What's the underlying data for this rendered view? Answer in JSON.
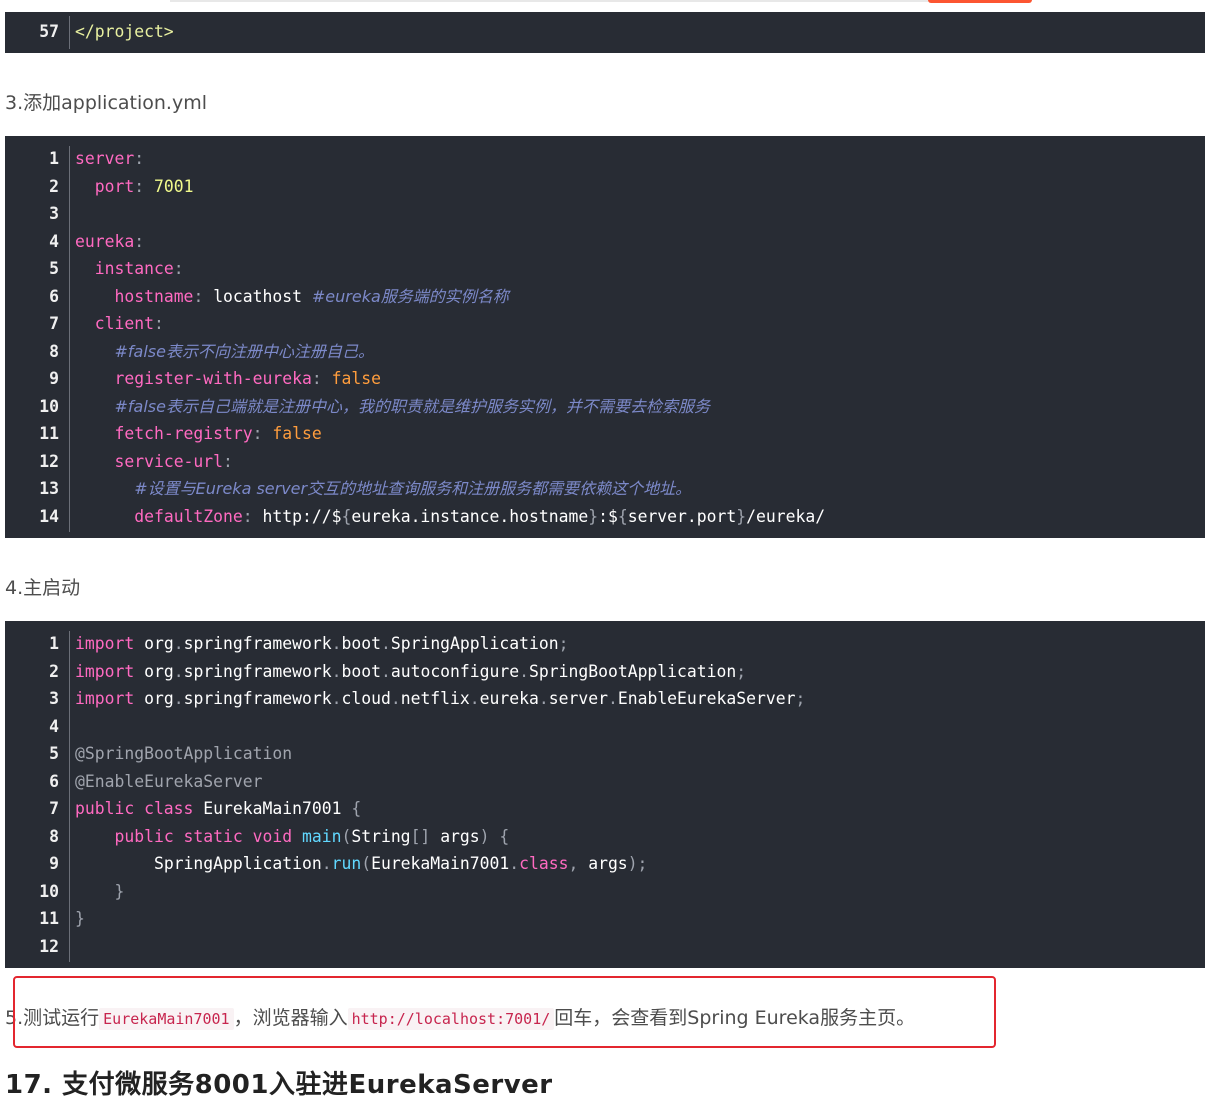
{
  "block_pom_tail": {
    "line_number": "57",
    "line_text": "</project>"
  },
  "step3_text": "3.添加application.yml",
  "yml": {
    "line_numbers": [
      "1",
      "2",
      "3",
      "4",
      "5",
      "6",
      "7",
      "8",
      "9",
      "10",
      "11",
      "12",
      "13",
      "14"
    ],
    "server_key": "server",
    "port_key": "port",
    "port_value": "7001",
    "eureka_key": "eureka",
    "instance_key": "instance",
    "hostname_key": "hostname",
    "hostname_value": "locathost",
    "hostname_comment": "#eureka服务端的实例名称",
    "client_key": "client",
    "comment_register": "#false表示不向注册中心注册自己。",
    "register_key": "register-with-eureka",
    "register_value": "false",
    "comment_fetch": "#false表示自己端就是注册中心，我的职责就是维护服务实例，并不需要去检索服务",
    "fetch_key": "fetch-registry",
    "fetch_value": "false",
    "service_url_key": "service-url",
    "comment_default_zone": "#设置与Eureka server交互的地址查询服务和注册服务都需要依赖这个地址。",
    "default_zone_key": "defaultZone",
    "default_zone_value_parts": [
      "http://$",
      "eureka.instance.hostname",
      "$",
      "server.port",
      "/eureka/"
    ]
  },
  "step4_text": "4.主启动",
  "java": {
    "line_numbers": [
      "1",
      "2",
      "3",
      "4",
      "5",
      "6",
      "7",
      "8",
      "9",
      "10",
      "11",
      "12"
    ],
    "import_keyword": "import",
    "import1": [
      "org",
      "springframework",
      "boot",
      "SpringApplication"
    ],
    "import2": [
      "org",
      "springframework",
      "boot",
      "autoconfigure",
      "SpringBootApplication"
    ],
    "import3": [
      "org",
      "springframework",
      "cloud",
      "netflix",
      "eureka",
      "server",
      "EnableEurekaServer"
    ],
    "annotation1": "@SpringBootApplication",
    "annotation2": "@EnableEurekaServer",
    "class_modifiers": "public class",
    "class_name": "EurekaMain7001",
    "method_modifiers": "public static void",
    "method_name": "main",
    "param_type": "String",
    "param_name": "args",
    "call_target": "SpringApplication",
    "call_method": "run",
    "call_arg_class": "EurekaMain7001",
    "class_keyword": "class",
    "call_arg2": "args"
  },
  "step5": {
    "prefix": "5.测试运行",
    "code1": "EurekaMain7001",
    "middle": "，浏览器输入",
    "code2": "http://localhost:7001/",
    "suffix": "回车，会查看到Spring Eureka服务主页。"
  },
  "next_heading": "17. 支付微服务8001入驻进EurekaServer"
}
